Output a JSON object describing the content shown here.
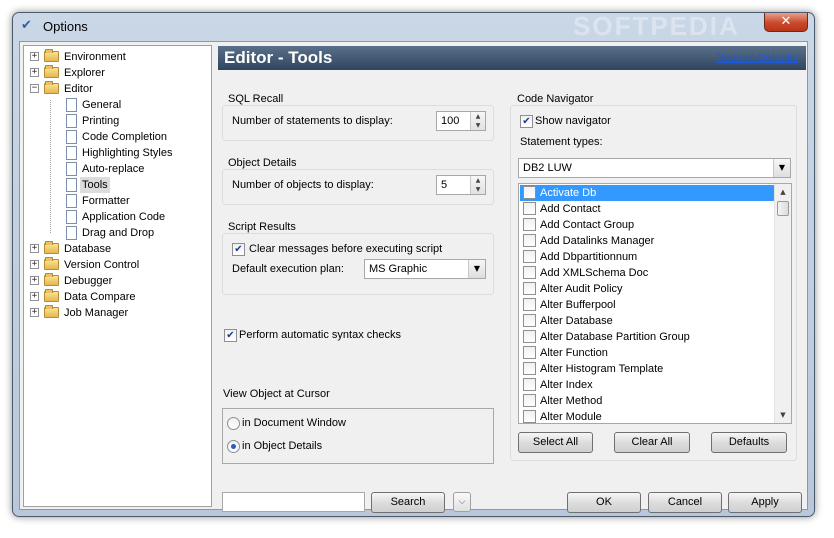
{
  "window": {
    "title": "Options",
    "watermark": "SOFTPEDIA",
    "close_label": "✕"
  },
  "tree": {
    "items": [
      {
        "label": "Environment",
        "expander": "+"
      },
      {
        "label": "Explorer",
        "expander": "+"
      },
      {
        "label": "Editor",
        "expander": "−"
      },
      {
        "label": "General"
      },
      {
        "label": "Printing"
      },
      {
        "label": "Code Completion"
      },
      {
        "label": "Highlighting Styles"
      },
      {
        "label": "Auto-replace"
      },
      {
        "label": "Tools"
      },
      {
        "label": "Formatter"
      },
      {
        "label": "Application Code"
      },
      {
        "label": "Drag and Drop"
      },
      {
        "label": "Database",
        "expander": "+"
      },
      {
        "label": "Version Control",
        "expander": "+"
      },
      {
        "label": "Debugger",
        "expander": "+"
      },
      {
        "label": "Data Compare",
        "expander": "+"
      },
      {
        "label": "Job Manager",
        "expander": "+"
      }
    ]
  },
  "header": {
    "title": "Editor - Tools",
    "restore_link": "Restore Defaults"
  },
  "sql_recall": {
    "group_label": "SQL Recall",
    "label": "Number of statements to display:",
    "value": "100"
  },
  "object_details": {
    "group_label": "Object Details",
    "label": "Number of objects to display:",
    "value": "5"
  },
  "script_results": {
    "group_label": "Script Results",
    "clear_label": "Clear messages before executing script",
    "clear_checked": "✔",
    "plan_label": "Default execution plan:",
    "plan_value": "MS Graphic"
  },
  "syntax_checks": {
    "label": "Perform automatic syntax checks",
    "checked": "✔"
  },
  "view_object": {
    "group_label": "View Object at Cursor",
    "option1": "in Document Window",
    "option2": "in Object Details",
    "selected": "in Object Details"
  },
  "code_navigator": {
    "group_label": "Code Navigator",
    "show_label": "Show navigator",
    "show_checked": "✔",
    "types_label": "Statement types:",
    "db_value": "DB2 LUW",
    "statements": [
      "Activate Db",
      "Add Contact",
      "Add Contact Group",
      "Add Datalinks Manager",
      "Add Dbpartitionnum",
      "Add XMLSchema Doc",
      "Alter Audit Policy",
      "Alter Bufferpool",
      "Alter Database",
      "Alter Database Partition Group",
      "Alter Function",
      "Alter Histogram Template",
      "Alter Index",
      "Alter Method",
      "Alter Module"
    ],
    "select_all": "Select All",
    "clear_all": "Clear All",
    "defaults": "Defaults"
  },
  "footer": {
    "search_value": "",
    "search_button": "Search",
    "expand_glyph": "⌵",
    "ok": "OK",
    "cancel": "Cancel",
    "apply": "Apply"
  },
  "icons": {
    "app": "checklist-icon",
    "folder": "folder-icon",
    "page": "page-icon"
  }
}
